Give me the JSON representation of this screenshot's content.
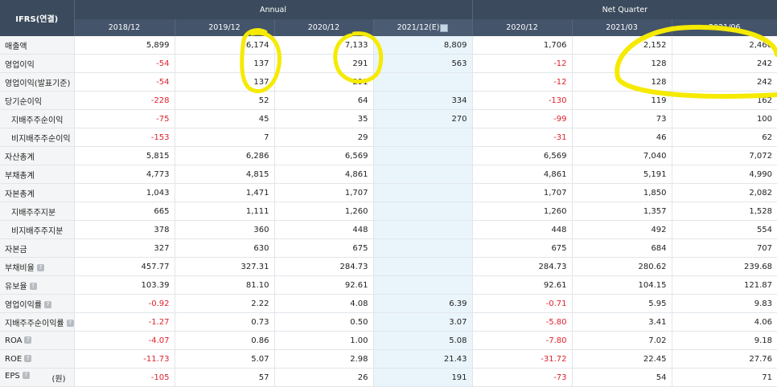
{
  "header": {
    "corner": "IFRS(연결)",
    "annual_label": "Annual",
    "quarter_label": "Net Quarter",
    "columns": [
      "2018/12",
      "2019/12",
      "2020/12",
      "2021/12(E)",
      "2020/12",
      "2021/03",
      "2021/06"
    ]
  },
  "rows": [
    {
      "label": "매출액",
      "values": [
        "5,899",
        "6,174",
        "7,133",
        "8,809",
        "1,706",
        "2,152",
        "2,466"
      ]
    },
    {
      "label": "영업이익",
      "values": [
        "-54",
        "137",
        "291",
        "563",
        "-12",
        "128",
        "242"
      ]
    },
    {
      "label": "영업이익(발표기준)",
      "values": [
        "-54",
        "137",
        "291",
        "",
        "-12",
        "128",
        "242"
      ]
    },
    {
      "label": "당기순이익",
      "values": [
        "-228",
        "52",
        "64",
        "334",
        "-130",
        "119",
        "162"
      ]
    },
    {
      "label": "지배주주순이익",
      "values": [
        "-75",
        "45",
        "35",
        "270",
        "-99",
        "73",
        "100"
      ]
    },
    {
      "label": "비지배주주순이익",
      "values": [
        "-153",
        "7",
        "29",
        "",
        "-31",
        "46",
        "62"
      ]
    },
    {
      "label": "자산총계",
      "values": [
        "5,815",
        "6,286",
        "6,569",
        "",
        "6,569",
        "7,040",
        "7,072"
      ]
    },
    {
      "label": "부채총계",
      "values": [
        "4,773",
        "4,815",
        "4,861",
        "",
        "4,861",
        "5,191",
        "4,990"
      ]
    },
    {
      "label": "자본총계",
      "values": [
        "1,043",
        "1,471",
        "1,707",
        "",
        "1,707",
        "1,850",
        "2,082"
      ]
    },
    {
      "label": "지배주주지분",
      "values": [
        "665",
        "1,111",
        "1,260",
        "",
        "1,260",
        "1,357",
        "1,528"
      ]
    },
    {
      "label": "비지배주주지분",
      "values": [
        "378",
        "360",
        "448",
        "",
        "448",
        "492",
        "554"
      ]
    },
    {
      "label": "자본금",
      "values": [
        "327",
        "630",
        "675",
        "",
        "675",
        "684",
        "707"
      ]
    },
    {
      "label": "부채비율",
      "values": [
        "457.77",
        "327.31",
        "284.73",
        "",
        "284.73",
        "280.62",
        "239.68"
      ]
    },
    {
      "label": "유보율",
      "values": [
        "103.39",
        "81.10",
        "92.61",
        "",
        "92.61",
        "104.15",
        "121.87"
      ]
    },
    {
      "label": "영업이익률",
      "values": [
        "-0.92",
        "2.22",
        "4.08",
        "6.39",
        "-0.71",
        "5.95",
        "9.83"
      ]
    },
    {
      "label": "지배주주순이익률",
      "values": [
        "-1.27",
        "0.73",
        "0.50",
        "3.07",
        "-5.80",
        "3.41",
        "4.06"
      ]
    },
    {
      "label": "ROA",
      "values": [
        "-4.07",
        "0.86",
        "1.00",
        "5.08",
        "-7.80",
        "7.02",
        "9.18"
      ]
    },
    {
      "label": "ROE",
      "values": [
        "-11.73",
        "5.07",
        "2.98",
        "21.43",
        "-31.72",
        "22.45",
        "27.76"
      ]
    },
    {
      "label": "EPS",
      "unit": "(원)",
      "values": [
        "-105",
        "57",
        "26",
        "191",
        "-73",
        "54",
        "71"
      ]
    }
  ],
  "help_icon_glyph": "?",
  "colors": {
    "header": "#3b4a5c",
    "estimate_bg": "#e9f5fb",
    "negative": "#e0202a",
    "highlight": "#f5ea00"
  }
}
